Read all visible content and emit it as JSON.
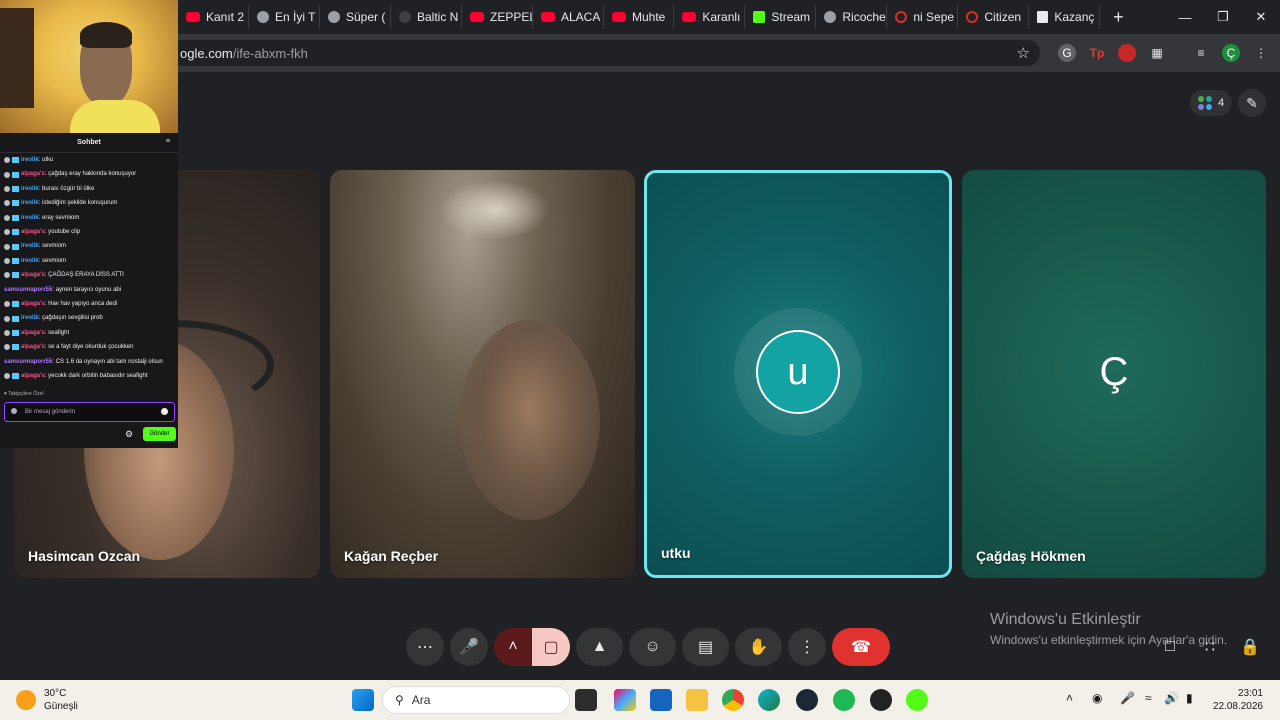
{
  "browser": {
    "tabs": [
      {
        "label": "Kanıt 2",
        "icon": "youtube-icon"
      },
      {
        "label": "En İyi T",
        "icon": "generic-icon"
      },
      {
        "label": "Süper (",
        "icon": "generic-icon"
      },
      {
        "label": "Baltic N",
        "icon": "globe-icon"
      },
      {
        "label": "ZEPPEL",
        "icon": "youtube-icon"
      },
      {
        "label": "ALACA",
        "icon": "youtube-icon"
      },
      {
        "label": "Muhte",
        "icon": "youtube-icon"
      },
      {
        "label": "Karanlı",
        "icon": "youtube-icon"
      },
      {
        "label": "Stream",
        "icon": "kick-icon"
      },
      {
        "label": "Ricoche",
        "icon": "generic-icon"
      },
      {
        "label": "ni Sepe",
        "icon": "ring-icon"
      },
      {
        "label": "Citizen",
        "icon": "ring-icon"
      },
      {
        "label": "Kazanç",
        "icon": "doc-icon"
      }
    ],
    "new_tab": "+",
    "address": {
      "host": "ogle.com",
      "path": "/ife-abxm-fkh"
    },
    "profile_letter": "Ç"
  },
  "meet": {
    "participant_count": "4",
    "tiles": [
      {
        "name": "Hasimcan Ozcan"
      },
      {
        "name": "Kağan Reçber"
      },
      {
        "name": "utku",
        "initial": "u"
      },
      {
        "name": "Çağdaş Hökmen",
        "initial": "Ç"
      }
    ],
    "activation": {
      "title": "Windows'u Etkinleştir",
      "subtitle": "Windows'u etkinleştirmek için Ayarlar'a gidin."
    }
  },
  "stream_chat": {
    "header": "Sohbet",
    "messages": [
      {
        "user": "ireolik",
        "text": "utku",
        "cls": "ire"
      },
      {
        "user": "alpaga's",
        "text": "çağdaş eray hakkında konuşuyor",
        "cls": "alp"
      },
      {
        "user": "ireolik",
        "text": "burası özgür bi ülke",
        "cls": "ire"
      },
      {
        "user": "ireolik",
        "text": "istediğim şekilde konuşurum",
        "cls": "ire"
      },
      {
        "user": "ireolik",
        "text": "eray sevmiom",
        "cls": "ire"
      },
      {
        "user": "alpaga's",
        "text": "youtube clip",
        "cls": "alp"
      },
      {
        "user": "ireolik",
        "text": "sevmiom",
        "cls": "ire"
      },
      {
        "user": "ireolik",
        "text": "sevmiom",
        "cls": "ire"
      },
      {
        "user": "alpaga's",
        "text": "ÇAĞDAŞ ERAYA DİSS ATTI",
        "cls": "alp"
      },
      {
        "user": "samsunnaporr55",
        "text": "aynen tarayıcı oyunu abi",
        "cls": "sam"
      },
      {
        "user": "alpaga's",
        "text": "Hav hav yapıyo anca dedi",
        "cls": "alp"
      },
      {
        "user": "ireolik",
        "text": "çağdaşın sevgilisi prob",
        "cls": "ire"
      },
      {
        "user": "alpaga's",
        "text": "seafight",
        "cls": "alp"
      },
      {
        "user": "alpaga's",
        "text": "se a fayt diye okurduk çocukken",
        "cls": "alp"
      },
      {
        "user": "samsunnaporr55",
        "text": "CS 1.6 da oynayın abi tam nostalji olsun",
        "cls": "sam"
      },
      {
        "user": "alpaga's",
        "text": "yecokk dark orbitin babasıdır seafight",
        "cls": "alp"
      }
    ],
    "followers_only": "Takipçilere Özel",
    "input_placeholder": "Bir mesaj gönderin",
    "send_label": "Gönder"
  },
  "taskbar": {
    "temperature": "30°C",
    "condition": "Güneşli",
    "search_label": "Ara",
    "time": "23:01",
    "date": "22.08.2026"
  }
}
